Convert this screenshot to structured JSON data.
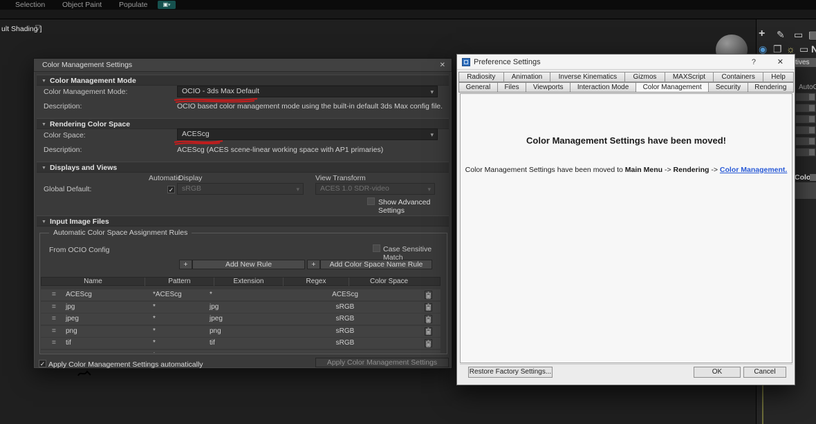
{
  "colors": {
    "annotation_red": "#c21d1d",
    "link_blue": "#2a5bd7",
    "accent_teal": "#16514e",
    "axis_yellow": "#6d6d39"
  },
  "icons": {
    "close": "✕",
    "help": "?",
    "dropdown_arrow": "▾",
    "check": "✓",
    "section_arrow": "▼",
    "plus": "+",
    "funnel": "▽",
    "drag_handle": "=",
    "menu_tool_glyph": "▣",
    "menu_caret": "▾",
    "create_glyph": "+",
    "modify_glyph": "✎",
    "monitor_glyph": "▭",
    "grid_glyph": "▤",
    "motion_glyph": "◉",
    "layers_glyph": "❐",
    "bulb_glyph": "☼",
    "n_glyph": "N"
  },
  "background": {
    "menubar_items": [
      "Selection",
      "Object Paint",
      "Populate"
    ],
    "viewport_label": "ult Shading ]",
    "right_fragments": {
      "primitives": "tives",
      "autogrid": "AutoGr",
      "color": "Color"
    }
  },
  "cms": {
    "title": "Color Management Settings",
    "mode": {
      "header": "Color Management Mode",
      "label": "Color Management Mode:",
      "value": "OCIO - 3ds Max Default",
      "description_label": "Description:",
      "description": "OCIO based color management mode using the built-in default 3ds Max config file."
    },
    "rendering": {
      "header": "Rendering Color Space",
      "label": "Color Space:",
      "value": "ACEScg",
      "description_label": "Description:",
      "description": "ACEScg (ACES scene-linear working space with AP1 primaries)"
    },
    "displays": {
      "header": "Displays and Views",
      "automatic": "Automatic",
      "display": "Display",
      "view_transform": "View Transform",
      "global_default": "Global Default:",
      "display_value": "sRGB",
      "view_transform_value": "ACES 1.0 SDR-video",
      "show_advanced": "Show Advanced Settings"
    },
    "input": {
      "header": "Input Image Files",
      "group": "Automatic Color Space Assignment Rules",
      "from": "From OCIO Config",
      "case_sensitive": "Case Sensitive Match",
      "add_rule": "Add New Rule",
      "add_cs_rule": "Add Color Space Name Rule",
      "headers": [
        "Name",
        "Pattern",
        "Extension",
        "Regex",
        "Color Space"
      ],
      "rows": [
        {
          "name": "ACEScg",
          "pattern": "*ACEScg",
          "extension": "*",
          "regex": "",
          "color_space": "ACEScg"
        },
        {
          "name": "jpg",
          "pattern": "*",
          "extension": "jpg",
          "regex": "",
          "color_space": "sRGB"
        },
        {
          "name": "jpeg",
          "pattern": "*",
          "extension": "jpeg",
          "regex": "",
          "color_space": "sRGB"
        },
        {
          "name": "png",
          "pattern": "*",
          "extension": "png",
          "regex": "",
          "color_space": "sRGB"
        },
        {
          "name": "tif",
          "pattern": "*",
          "extension": "tif",
          "regex": "",
          "color_space": "sRGB"
        }
      ],
      "partial_row_pattern": "*"
    },
    "footer": {
      "auto_apply": "Apply Color Management Settings automatically",
      "apply": "Apply Color Management Settings"
    }
  },
  "pref": {
    "title": "Preference Settings",
    "tabs_row1": [
      "Radiosity",
      "Animation",
      "Inverse Kinematics",
      "Gizmos",
      "MAXScript",
      "Containers",
      "Help"
    ],
    "tabs_row2": [
      "General",
      "Files",
      "Viewports",
      "Interaction Mode",
      "Color Management",
      "Security",
      "Rendering"
    ],
    "heading": "Color Management Settings have been moved!",
    "body": {
      "prefix": "Color Management Settings have been moved to ",
      "bold1": "Main Menu",
      "sep1": " -> ",
      "bold2": "Rendering",
      "sep2": " -> ",
      "link": "Color Management."
    },
    "restore": "Restore Factory Settings...",
    "ok": "OK",
    "cancel": "Cancel"
  }
}
